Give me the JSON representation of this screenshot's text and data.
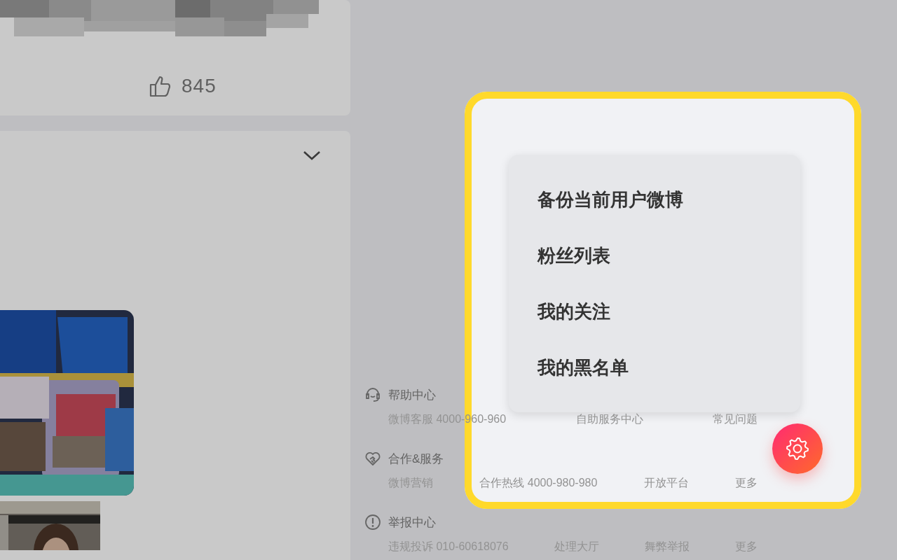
{
  "post": {
    "like_count": "845"
  },
  "menu": {
    "items": [
      {
        "label": "备份当前用户微博"
      },
      {
        "label": "粉丝列表"
      },
      {
        "label": "我的关注"
      },
      {
        "label": "我的黑名单"
      }
    ]
  },
  "footer": {
    "sections": [
      {
        "kind": "help",
        "title": "帮助中心",
        "links": [
          "微博客服 4000-960-960",
          "自助服务中心",
          "常见问题"
        ]
      },
      {
        "kind": "cooperation",
        "title": "合作&服务",
        "links": [
          "微博营销",
          "合作热线 4000-980-980",
          "开放平台",
          "更多"
        ]
      },
      {
        "kind": "report",
        "title": "举报中心",
        "links": [
          "违规投诉 010-60618076",
          "处理大厅",
          "舞弊举报",
          "更多"
        ]
      }
    ]
  }
}
